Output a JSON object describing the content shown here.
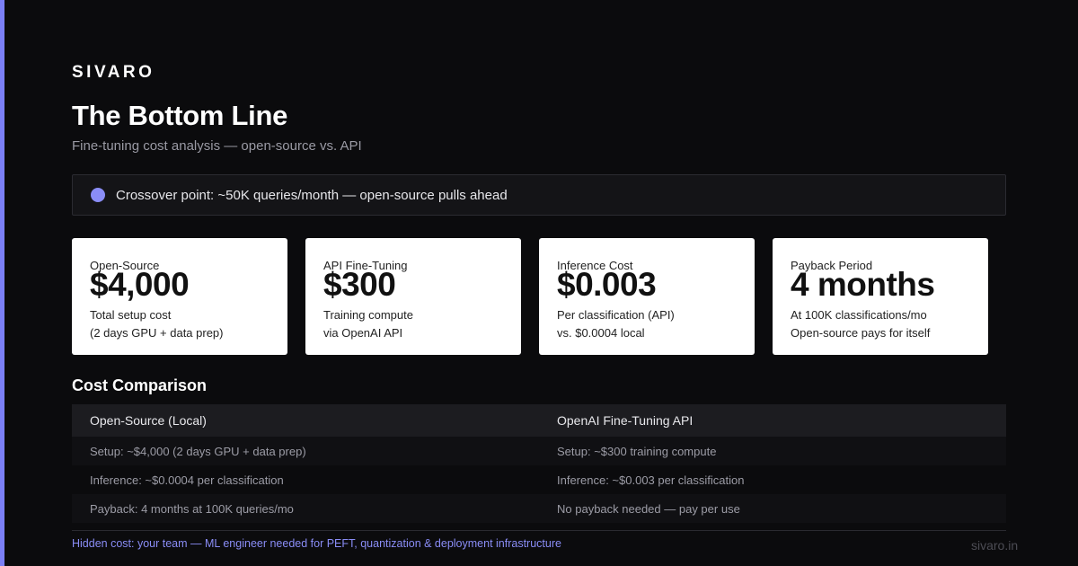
{
  "brand": "SIVARO",
  "title": "The Bottom Line",
  "subtitle": "Fine-tuning cost analysis — open-source vs. API",
  "callout": {
    "text": "Crossover point: ~50K queries/month — open-source pulls ahead",
    "dot_color": "#8a8df6"
  },
  "cards": [
    {
      "label": "Open-Source",
      "value": "$4,000",
      "line1": "Total setup cost",
      "line2": "(2 days GPU + data prep)"
    },
    {
      "label": "API Fine-Tuning",
      "value": "$300",
      "line1": "Training compute",
      "line2": "via OpenAI API"
    },
    {
      "label": "Inference Cost",
      "value": "$0.003",
      "line1": "Per classification (API)",
      "line2": "vs. $0.0004 local"
    },
    {
      "label": "Payback Period",
      "value": "4 months",
      "line1": "At 100K classifications/mo",
      "line2": "Open-source pays for itself"
    }
  ],
  "comparison": {
    "title": "Cost Comparison",
    "columns": [
      {
        "header": "Open-Source (Local)",
        "rows": [
          "Setup: ~$4,000 (2 days GPU + data prep)",
          "Inference: ~$0.0004 per classification",
          "Payback: 4 months at 100K queries/mo"
        ]
      },
      {
        "header": "OpenAI Fine-Tuning API",
        "rows": [
          "Setup: ~$300 training compute",
          "Inference: ~$0.003 per classification",
          "No payback needed — pay per use"
        ]
      }
    ]
  },
  "footnote": "Hidden cost: your team — ML engineer needed for PEFT, quantization & deployment infrastructure",
  "site": "sivaro.in",
  "colors": {
    "accent": "#7b7ff5",
    "background": "#0b0b0d",
    "card": "#ffffff"
  }
}
